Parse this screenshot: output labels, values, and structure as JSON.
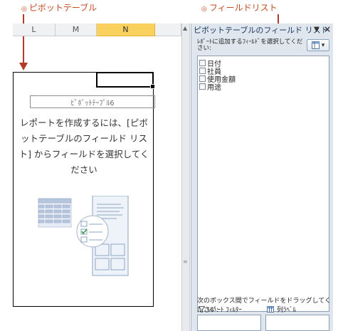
{
  "callouts": {
    "left": "ピボットテーブル",
    "right": "フィールドリスト",
    "mark": "◎"
  },
  "sheet": {
    "columns": [
      "L",
      "M",
      "N"
    ],
    "active_column": "N",
    "pivot_name": "ﾋﾟﾎﾞｯﾄﾃｰﾌﾞﾙ6",
    "pivot_message": "レポートを作成するには、[ピボットテーブルのフィールド リスト] からフィールドを選択してください"
  },
  "field_list": {
    "title": "ピボットテーブルのフィールド リスト",
    "dropdown_glyph": "▼",
    "close_glyph": "×",
    "instruction": "ﾚﾎﾟｰﾄに追加するﾌｨｰﾙﾄﾞを選択してください:",
    "fields": [
      "日付",
      "社員",
      "使用金額",
      "用途"
    ],
    "drag_hint": "次のボックス間でフィールドをドラッグしてください:",
    "areas": [
      "ﾚﾎﾟｰﾄ ﾌｨﾙﾀｰ",
      "列ﾗﾍﾞﾙ"
    ]
  },
  "colors": {
    "accent": "#b23a2a",
    "active_column": "#f9d15c",
    "pane_bg": "#dfe6ee"
  }
}
